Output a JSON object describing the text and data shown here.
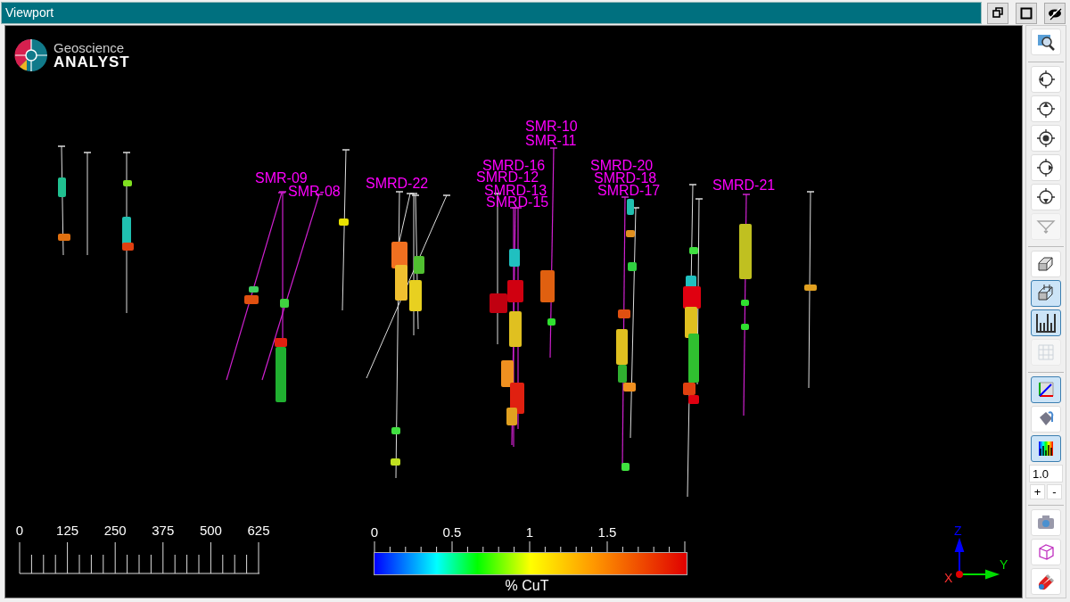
{
  "window": {
    "title": "Viewport"
  },
  "logo": {
    "line_1": "Geoscience",
    "line_2": "ANALYST"
  },
  "hole_labels": [
    "SMR-10",
    "SMR-11",
    "SMRD-16",
    "SMRD-12",
    "SMRD-13",
    "SMRD-15",
    "SMR-09",
    "SMR-08",
    "SMRD-22",
    "SMRD-20",
    "SMRD-18",
    "SMRD-17",
    "SMRD-21"
  ],
  "scale_bar": {
    "ticks": [
      "0",
      "125",
      "250",
      "375",
      "500",
      "625"
    ]
  },
  "color_legend": {
    "ticks": [
      "0",
      "0.5",
      "1",
      "1.5"
    ],
    "title": "% CuT"
  },
  "axis_triad": {
    "z": "Z",
    "y": "Y",
    "x": "X"
  },
  "toolbar": {
    "groups": [
      [
        {
          "selected": false,
          "disabled": false
        }
      ],
      [
        {
          "selected": false,
          "disabled": false
        },
        {
          "selected": false,
          "disabled": false
        },
        {
          "selected": false,
          "disabled": false
        },
        {
          "selected": false,
          "disabled": false
        },
        {
          "selected": false,
          "disabled": false
        },
        {
          "selected": false,
          "disabled": true
        }
      ],
      [
        {
          "selected": false,
          "disabled": false
        },
        {
          "selected": true,
          "disabled": false
        },
        {
          "selected": true,
          "disabled": false
        },
        {
          "selected": false,
          "disabled": true
        }
      ],
      [
        {
          "selected": true,
          "disabled": false
        },
        {
          "selected": false,
          "disabled": false
        },
        {
          "selected": true,
          "disabled": false
        }
      ],
      [
        {
          "selected": false,
          "disabled": false
        },
        {
          "selected": false,
          "disabled": false
        },
        {
          "selected": false,
          "disabled": false
        }
      ]
    ],
    "scale_value": "1.0",
    "step_buttons": [
      "+",
      "-"
    ]
  }
}
